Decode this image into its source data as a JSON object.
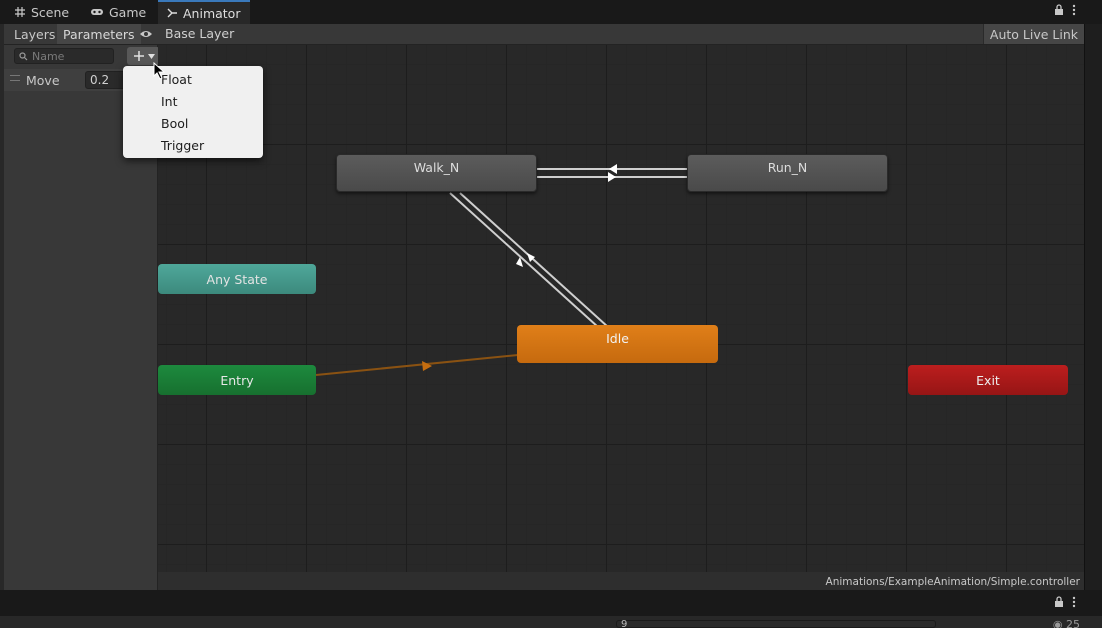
{
  "tabs": [
    {
      "label": "Scene",
      "icon": "grid-icon"
    },
    {
      "label": "Game",
      "icon": "gamepad-icon"
    },
    {
      "label": "Animator",
      "icon": "animator-icon",
      "active": true
    }
  ],
  "toolbar": {
    "layers_label": "Layers",
    "parameters_label": "Parameters",
    "breadcrumb": "Base Layer",
    "auto_live_link": "Auto Live Link"
  },
  "params": {
    "search_placeholder": "Name",
    "items": [
      {
        "name": "Move",
        "value": "0.2"
      }
    ]
  },
  "dropdown": {
    "items": [
      "Float",
      "Int",
      "Bool",
      "Trigger"
    ]
  },
  "graph": {
    "nodes": {
      "walk": "Walk_N",
      "run": "Run_N",
      "any_state": "Any State",
      "entry": "Entry",
      "idle": "Idle",
      "exit": "Exit"
    },
    "path": "Animations/ExampleAnimation/Simple.controller"
  },
  "bottom": {
    "search_value": "9",
    "count": "25"
  },
  "colors": {
    "entry": "#1d8a3e",
    "any_state": "#4fa89a",
    "default_state": "#e07f19",
    "exit": "#bc1e1e",
    "state": "#555555",
    "tab_accent": "#3a79bb"
  }
}
